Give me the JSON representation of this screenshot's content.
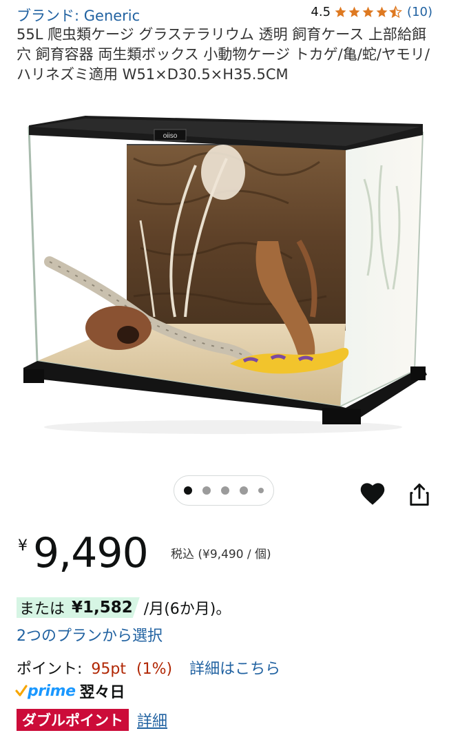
{
  "header": {
    "brand": "ブランド: Generic",
    "rating_value": "4.5",
    "rating_stars": 4.5,
    "rating_count": "(10)"
  },
  "product": {
    "title": "55L 爬虫類ケージ グラステラリウム 透明 飼育ケース 上部給餌穴 飼育容器 両生類ボックス 小動物ケージ トカゲ/亀/蛇/ヤモリ/ハリネズミ適用 W51×D30.5×H35.5CM",
    "image_logo_text": "oiiso"
  },
  "carousel": {
    "dots": 5,
    "active_index": 0
  },
  "actions": {
    "wishlist_icon": "heart-icon",
    "share_icon": "share-icon"
  },
  "price": {
    "currency_symbol": "¥",
    "whole": "9,490",
    "tax_note": "税込 (¥9,490 / 個)"
  },
  "installment": {
    "prefix": "または",
    "amount": "¥1,582",
    "period": "/月(6か月)。",
    "plans_link": "2つのプランから選択"
  },
  "points": {
    "label": "ポイント:",
    "value": "95pt",
    "percent": "(1%)",
    "detail_link": "詳細はこちら"
  },
  "delivery": {
    "prime_label": "prime",
    "day": "翌々日"
  },
  "badge": {
    "label": "ダブルポイント",
    "detail_link": "詳細"
  },
  "colors": {
    "link": "#2162a1",
    "star": "#de7921",
    "price_red": "#b12704",
    "badge_red": "#cc0c39",
    "installment_bg": "#d6f5e4",
    "prime_blue": "#1a98ff"
  }
}
